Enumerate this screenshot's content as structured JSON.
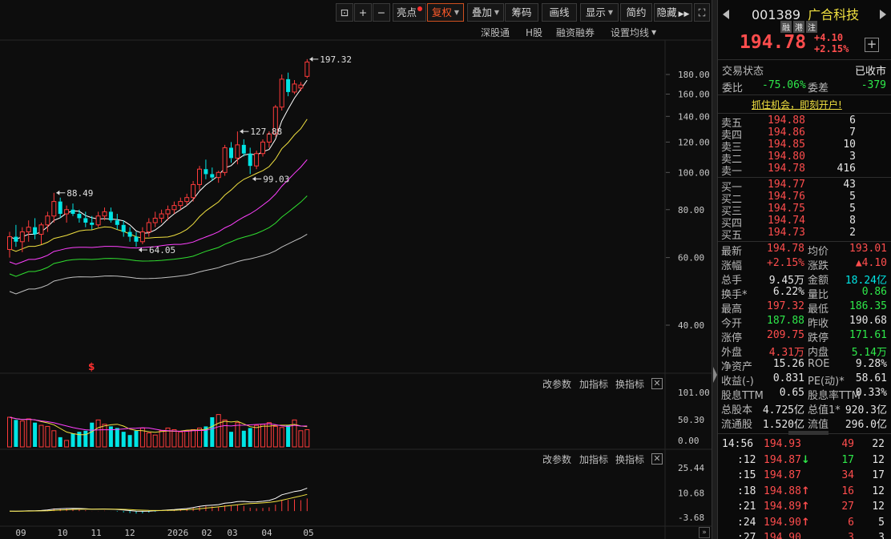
{
  "toolbar": {
    "highlight": "亮点",
    "fuquan": "复权",
    "overlay": "叠加",
    "chips": "筹码",
    "draw": "画线",
    "display": "显示",
    "simple": "简约",
    "hide": "隐藏",
    "sublinks": [
      "深股通",
      "H股",
      "融资融券",
      "设置均线"
    ]
  },
  "chart_data": [
    {
      "type": "candlestick",
      "title": "",
      "y_ticks": [
        "180.00",
        "160.00",
        "140.00",
        "120.00",
        "100.00",
        "80.00",
        "60.00",
        "40.00"
      ],
      "x_ticks": [
        "09",
        "10",
        "11",
        "12",
        "2026",
        "02",
        "03",
        "04",
        "05"
      ],
      "annotations": [
        "197.32",
        "127.88",
        "99.03",
        "88.49",
        "64.05"
      ],
      "marker": "$",
      "candles": [
        {
          "o": 63,
          "h": 70,
          "l": 60,
          "c": 68
        },
        {
          "o": 68,
          "h": 73,
          "l": 64,
          "c": 66
        },
        {
          "o": 66,
          "h": 72,
          "l": 62,
          "c": 70
        },
        {
          "o": 70,
          "h": 75,
          "l": 66,
          "c": 72
        },
        {
          "o": 72,
          "h": 76,
          "l": 67,
          "c": 69
        },
        {
          "o": 69,
          "h": 74,
          "l": 65,
          "c": 73
        },
        {
          "o": 73,
          "h": 79,
          "l": 70,
          "c": 77
        },
        {
          "o": 77,
          "h": 88.49,
          "l": 74,
          "c": 84
        },
        {
          "o": 84,
          "h": 86,
          "l": 76,
          "c": 78
        },
        {
          "o": 78,
          "h": 82,
          "l": 74,
          "c": 80
        },
        {
          "o": 80,
          "h": 83,
          "l": 77,
          "c": 78
        },
        {
          "o": 78,
          "h": 80,
          "l": 74,
          "c": 76
        },
        {
          "o": 76,
          "h": 79,
          "l": 72,
          "c": 74
        },
        {
          "o": 74,
          "h": 77,
          "l": 71,
          "c": 73
        },
        {
          "o": 73,
          "h": 79,
          "l": 72,
          "c": 77
        },
        {
          "o": 77,
          "h": 81,
          "l": 75,
          "c": 79
        },
        {
          "o": 79,
          "h": 81,
          "l": 74,
          "c": 75
        },
        {
          "o": 75,
          "h": 78,
          "l": 71,
          "c": 73
        },
        {
          "o": 73,
          "h": 75,
          "l": 68,
          "c": 70
        },
        {
          "o": 70,
          "h": 72,
          "l": 66,
          "c": 68
        },
        {
          "o": 68,
          "h": 70,
          "l": 64.05,
          "c": 66
        },
        {
          "o": 66,
          "h": 72,
          "l": 65,
          "c": 70
        },
        {
          "o": 70,
          "h": 76,
          "l": 68,
          "c": 74
        },
        {
          "o": 74,
          "h": 79,
          "l": 72,
          "c": 76
        },
        {
          "o": 76,
          "h": 80,
          "l": 74,
          "c": 78
        },
        {
          "o": 78,
          "h": 82,
          "l": 75,
          "c": 80
        },
        {
          "o": 80,
          "h": 84,
          "l": 78,
          "c": 82
        },
        {
          "o": 82,
          "h": 86,
          "l": 80,
          "c": 84
        },
        {
          "o": 84,
          "h": 88,
          "l": 82,
          "c": 86
        },
        {
          "o": 86,
          "h": 95,
          "l": 84,
          "c": 93
        },
        {
          "o": 93,
          "h": 104,
          "l": 90,
          "c": 102
        },
        {
          "o": 102,
          "h": 108,
          "l": 96,
          "c": 99
        },
        {
          "o": 99,
          "h": 103,
          "l": 95,
          "c": 97
        },
        {
          "o": 97,
          "h": 101,
          "l": 94,
          "c": 100
        },
        {
          "o": 100,
          "h": 118,
          "l": 98,
          "c": 116
        },
        {
          "o": 116,
          "h": 120,
          "l": 106,
          "c": 109
        },
        {
          "o": 109,
          "h": 127.88,
          "l": 105,
          "c": 118
        },
        {
          "o": 118,
          "h": 122,
          "l": 110,
          "c": 112
        },
        {
          "o": 112,
          "h": 116,
          "l": 99.03,
          "c": 104
        },
        {
          "o": 104,
          "h": 114,
          "l": 102,
          "c": 112
        },
        {
          "o": 112,
          "h": 122,
          "l": 110,
          "c": 120
        },
        {
          "o": 120,
          "h": 128,
          "l": 116,
          "c": 126
        },
        {
          "o": 126,
          "h": 150,
          "l": 124,
          "c": 148
        },
        {
          "o": 148,
          "h": 180,
          "l": 145,
          "c": 175
        },
        {
          "o": 175,
          "h": 182,
          "l": 158,
          "c": 162
        },
        {
          "o": 162,
          "h": 174,
          "l": 160,
          "c": 170
        },
        {
          "o": 166,
          "h": 172,
          "l": 163,
          "c": 169
        },
        {
          "o": 178,
          "h": 197.32,
          "l": 176,
          "c": 194
        }
      ]
    },
    {
      "type": "bar",
      "name": "volume",
      "y_ticks": [
        "101.00",
        "50.30",
        "0.00"
      ],
      "values": [
        55,
        50,
        48,
        52,
        45,
        40,
        38,
        30,
        18,
        12,
        25,
        28,
        30,
        45,
        50,
        42,
        38,
        35,
        28,
        22,
        30,
        35,
        26,
        22,
        30,
        35,
        32,
        28,
        30,
        32,
        35,
        38,
        55,
        60,
        50,
        28,
        45,
        30,
        35,
        40,
        42,
        45,
        38,
        36,
        40,
        50,
        30,
        32
      ]
    },
    {
      "type": "bar",
      "name": "macd",
      "y_ticks": [
        "25.44",
        "10.68",
        "-3.68"
      ]
    }
  ],
  "panel_controls": {
    "change_params": "改参数",
    "add_indicator": "加指标",
    "switch_indicator": "换指标",
    "close": "✕"
  },
  "stock": {
    "code": "001389",
    "name": "广合科技",
    "tags": [
      "融",
      "港",
      "注"
    ],
    "price": "194.78",
    "change": "+4.10",
    "change_pct": "+2.15%"
  },
  "status": {
    "label": "交易状态",
    "value": "已收市"
  },
  "ratio": {
    "wb_label": "委比",
    "wb": "-75.06%",
    "wc_label": "委差",
    "wc": "-379"
  },
  "promo": "抓住机会，即刻开户!",
  "asks": [
    {
      "label": "卖五",
      "price": "194.88",
      "vol": "6"
    },
    {
      "label": "卖四",
      "price": "194.86",
      "vol": "7"
    },
    {
      "label": "卖三",
      "price": "194.85",
      "vol": "10"
    },
    {
      "label": "卖二",
      "price": "194.80",
      "vol": "3"
    },
    {
      "label": "卖一",
      "price": "194.78",
      "vol": "416"
    }
  ],
  "bids": [
    {
      "label": "买一",
      "price": "194.77",
      "vol": "43"
    },
    {
      "label": "买二",
      "price": "194.76",
      "vol": "5"
    },
    {
      "label": "买三",
      "price": "194.75",
      "vol": "5"
    },
    {
      "label": "买四",
      "price": "194.74",
      "vol": "8"
    },
    {
      "label": "买五",
      "price": "194.73",
      "vol": "2"
    }
  ],
  "stats": [
    {
      "l1": "最新",
      "v1": "194.78",
      "c1": "red",
      "l2": "均价",
      "v2": "193.01",
      "c2": "red"
    },
    {
      "l1": "涨幅",
      "v1": "+2.15%",
      "c1": "red",
      "l2": "涨跌",
      "v2": "▲4.10",
      "c2": "red"
    },
    {
      "l1": "总手",
      "v1": "9.45万",
      "c1": "white",
      "l2": "金额",
      "v2": "18.24亿",
      "c2": "cyan"
    },
    {
      "l1": "换手*",
      "v1": "6.22%",
      "c1": "white",
      "l2": "量比",
      "v2": "0.86",
      "c2": "green"
    },
    {
      "l1": "最高",
      "v1": "197.32",
      "c1": "red",
      "l2": "最低",
      "v2": "186.35",
      "c2": "green"
    },
    {
      "l1": "今开",
      "v1": "187.88",
      "c1": "green",
      "l2": "昨收",
      "v2": "190.68",
      "c2": "white"
    },
    {
      "l1": "涨停",
      "v1": "209.75",
      "c1": "red",
      "l2": "跌停",
      "v2": "171.61",
      "c2": "green"
    },
    {
      "l1": "外盘",
      "v1": "4.31万",
      "c1": "red",
      "l2": "内盘",
      "v2": "5.14万",
      "c2": "green"
    },
    {
      "l1": "净资产",
      "v1": "15.26",
      "c1": "white",
      "l2": "ROE",
      "v2": "9.28%",
      "c2": "white"
    },
    {
      "l1": "收益(-)",
      "v1": "0.831",
      "c1": "white",
      "l2": "PE(动)*",
      "v2": "58.61",
      "c2": "white"
    },
    {
      "l1": "股息TTM",
      "v1": "0.65",
      "c1": "white",
      "l2": "股息率TTM",
      "v2": "0.33%",
      "c2": "white"
    },
    {
      "l1": "总股本",
      "v1": "4.725亿",
      "c1": "white",
      "l2": "总值1*",
      "v2": "920.3亿",
      "c2": "white"
    },
    {
      "l1": "流通股",
      "v1": "1.520亿",
      "c1": "white",
      "l2": "流值",
      "v2": "296.0亿",
      "c2": "white"
    }
  ],
  "ticks": [
    {
      "time": "14:56",
      "price": "194.93",
      "arrow": "",
      "vol": "49",
      "vcolor": "red",
      "n": "22"
    },
    {
      "time": ":12",
      "price": "194.87",
      "arrow": "down",
      "vol": "17",
      "vcolor": "green",
      "n": "12"
    },
    {
      "time": ":15",
      "price": "194.87",
      "arrow": "",
      "vol": "34",
      "vcolor": "red",
      "n": "17"
    },
    {
      "time": ":18",
      "price": "194.88",
      "arrow": "up",
      "vol": "16",
      "vcolor": "red",
      "n": "12"
    },
    {
      "time": ":21",
      "price": "194.89",
      "arrow": "up",
      "vol": "27",
      "vcolor": "red",
      "n": "12"
    },
    {
      "time": ":24",
      "price": "194.90",
      "arrow": "up",
      "vol": "6",
      "vcolor": "red",
      "n": "5"
    },
    {
      "time": ":27",
      "price": "194.90",
      "arrow": "",
      "vol": "3",
      "vcolor": "red",
      "n": "3"
    }
  ]
}
